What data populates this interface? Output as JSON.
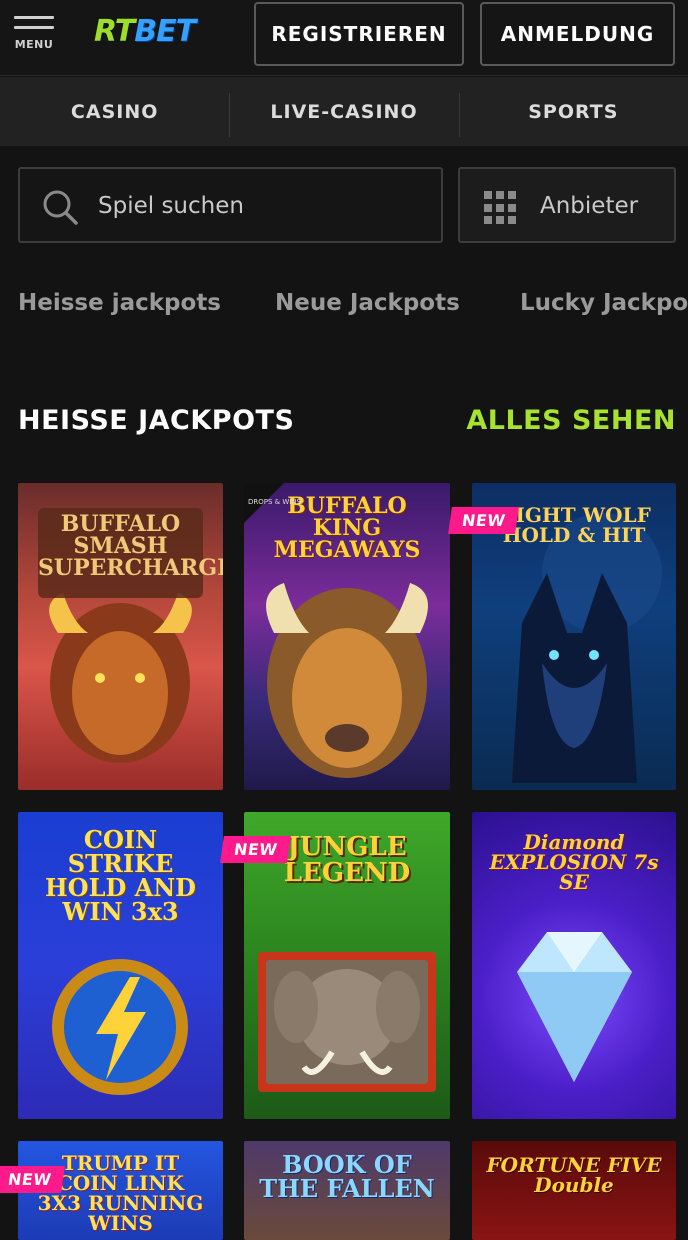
{
  "header": {
    "menu_label": "MENU",
    "logo_part1": "RT",
    "logo_part2": "BET",
    "register_label": "REGISTRIEREN",
    "login_label": "ANMELDUNG"
  },
  "nav": {
    "tabs": [
      {
        "label": "CASINO"
      },
      {
        "label": "LIVE-CASINO"
      },
      {
        "label": "SPORTS"
      }
    ]
  },
  "search": {
    "placeholder": "Spiel suchen",
    "provider_label": "Anbieter",
    "icon": "search-icon",
    "provider_icon": "grid-icon"
  },
  "categories": [
    {
      "label": "Heisse jackpots"
    },
    {
      "label": "Neue Jackpots"
    },
    {
      "label": "Lucky Jackpots"
    }
  ],
  "section": {
    "title": "HEISSE JACKPOTS",
    "see_all": "ALLES SEHEN"
  },
  "games": [
    {
      "title": "BUFFALO SMASH SUPERCHARGED",
      "badge": ""
    },
    {
      "title": "BUFFALO KING MEGAWAYS",
      "badge": "",
      "tag": "DROPS & WINS"
    },
    {
      "title": "NIGHT WOLF HOLD & HIT",
      "badge": "NEW"
    },
    {
      "title": "COIN STRIKE HOLD AND WIN 3x3",
      "badge": ""
    },
    {
      "title": "JUNGLE LEGEND",
      "badge": "NEW"
    },
    {
      "title": "Diamond EXPLOSION 7s SE",
      "badge": ""
    },
    {
      "title": "TRUMP IT COIN LINK 3X3 RUNNING WINS",
      "badge": "NEW"
    },
    {
      "title": "BOOK OF THE FALLEN",
      "badge": ""
    },
    {
      "title": "FORTUNE FIVE Double",
      "badge": ""
    }
  ],
  "colors": {
    "accent_green": "#a6e22e",
    "badge_pink": "#ff1a8c",
    "logo_blue": "#35a0ff"
  }
}
